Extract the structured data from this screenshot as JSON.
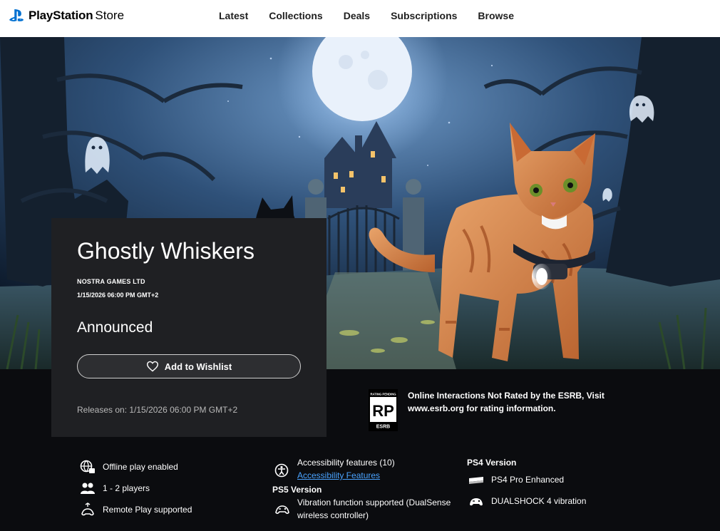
{
  "header": {
    "brand": "PlayStation",
    "brand_suffix": "Store",
    "nav": [
      "Latest",
      "Collections",
      "Deals",
      "Subscriptions",
      "Browse"
    ]
  },
  "game": {
    "title": "Ghostly Whiskers",
    "publisher": "NOSTRA GAMES LTD",
    "release_datetime": "1/15/2026 06:00 PM GMT+2",
    "status": "Announced",
    "wishlist_label": "Add to Wishlist",
    "releases_on": "Releases on: 1/15/2026 06:00 PM GMT+2"
  },
  "esrb": {
    "badge_top": "RATING PENDING",
    "badge_code": "RP",
    "badge_bottom": "ESRB",
    "text": "Online Interactions Not Rated by the ESRB, Visit www.esrb.org for rating information."
  },
  "features": {
    "left": [
      "Offline play enabled",
      "1 - 2 players",
      "Remote Play supported"
    ],
    "middle": {
      "accessibility": "Accessibility features (10)",
      "accessibility_link": "Accessibility Features",
      "ps5_title": "PS5 Version",
      "vibration": "Vibration function supported (DualSense wireless controller)"
    },
    "right": {
      "ps4_title": "PS4 Version",
      "ps4_pro": "PS4 Pro Enhanced",
      "dualshock": "DUALSHOCK 4 vibration"
    }
  },
  "colors": {
    "accent_link": "#4aa3ff",
    "card_bg": "#1f2023",
    "page_bg": "#0b0c0f"
  }
}
